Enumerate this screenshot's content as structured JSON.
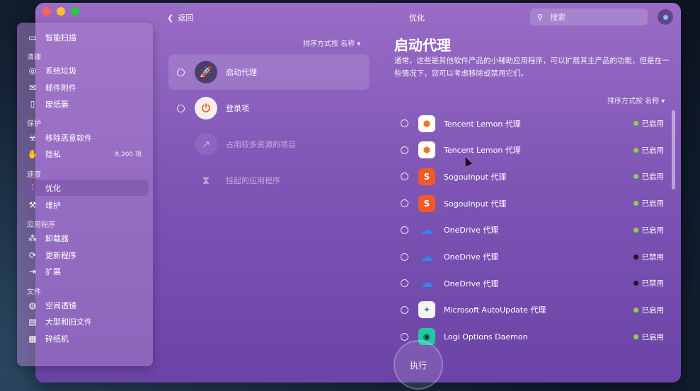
{
  "topbar": {
    "back_label": "返回",
    "title": "优化",
    "search_placeholder": "搜索"
  },
  "sidebar": {
    "top_item": {
      "label": "智能扫描",
      "icon": "monitor-icon"
    },
    "sections": [
      {
        "header": "清理",
        "items": [
          {
            "label": "系统垃圾",
            "icon": "disk-icon"
          },
          {
            "label": "邮件附件",
            "icon": "mail-icon"
          },
          {
            "label": "废纸篓",
            "icon": "trash-icon"
          }
        ]
      },
      {
        "header": "保护",
        "items": [
          {
            "label": "移除恶意软件",
            "icon": "biohazard-icon"
          },
          {
            "label": "隐私",
            "icon": "hand-icon",
            "count": "8,200 项"
          }
        ]
      },
      {
        "header": "速度",
        "items": [
          {
            "label": "优化",
            "icon": "sliders-icon",
            "active": true
          },
          {
            "label": "维护",
            "icon": "wrench-icon"
          }
        ]
      },
      {
        "header": "应用程序",
        "items": [
          {
            "label": "卸载器",
            "icon": "apps-icon"
          },
          {
            "label": "更新程序",
            "icon": "update-icon"
          },
          {
            "label": "扩展",
            "icon": "extension-icon"
          }
        ]
      },
      {
        "header": "文件",
        "items": [
          {
            "label": "空间透镜",
            "icon": "lens-icon"
          },
          {
            "label": "大型和旧文件",
            "icon": "folder-icon"
          },
          {
            "label": "碎纸机",
            "icon": "shredder-icon"
          }
        ]
      }
    ]
  },
  "middle": {
    "sort_label": "排序方式按 名称 ▾",
    "items": [
      {
        "label": "启动代理",
        "icon": "rocket-icon",
        "active": true
      },
      {
        "label": "登录项",
        "icon": "power-icon"
      },
      {
        "label": "占用较多资源的项目",
        "icon": "chart-icon",
        "dim": true
      },
      {
        "label": "挂起的应用程序",
        "icon": "hourglass-icon",
        "dim": true
      }
    ]
  },
  "right": {
    "title": "启动代理",
    "description": "通常，这些是其他软件产品的小辅助应用程序，可以扩展其主产品的功能，但是在一些情况下，您可以考虑移除或禁用它们。",
    "sort_label": "排序方式按 名称 ▾",
    "rows": [
      {
        "name": "Tencent Lemon 代理",
        "icon": "lemon-icon",
        "status": "已启用",
        "enabled": true
      },
      {
        "name": "Tencent Lemon 代理",
        "icon": "lemon-icon",
        "status": "已启用",
        "enabled": true
      },
      {
        "name": "SogouInput 代理",
        "icon": "sogou-icon",
        "status": "已启用",
        "enabled": true
      },
      {
        "name": "SogouInput 代理",
        "icon": "sogou-icon",
        "status": "已启用",
        "enabled": true
      },
      {
        "name": "OneDrive 代理",
        "icon": "onedrive-icon",
        "status": "已启用",
        "enabled": true
      },
      {
        "name": "OneDrive 代理",
        "icon": "onedrive-icon",
        "status": "已禁用",
        "enabled": false
      },
      {
        "name": "OneDrive 代理",
        "icon": "onedrive-icon",
        "status": "已禁用",
        "enabled": false
      },
      {
        "name": "Microsoft AutoUpdate 代理",
        "icon": "autoupdate-icon",
        "status": "已启用",
        "enabled": true
      },
      {
        "name": "Logi Options Daemon",
        "icon": "logi-icon",
        "status": "已启用",
        "enabled": true
      }
    ]
  },
  "run_button_label": "执行",
  "colors": {
    "enabled": "#8bd24a",
    "disabled": "#1a1a1a",
    "window_top": "#9a6cc6",
    "window_bottom": "#6a44a6"
  }
}
